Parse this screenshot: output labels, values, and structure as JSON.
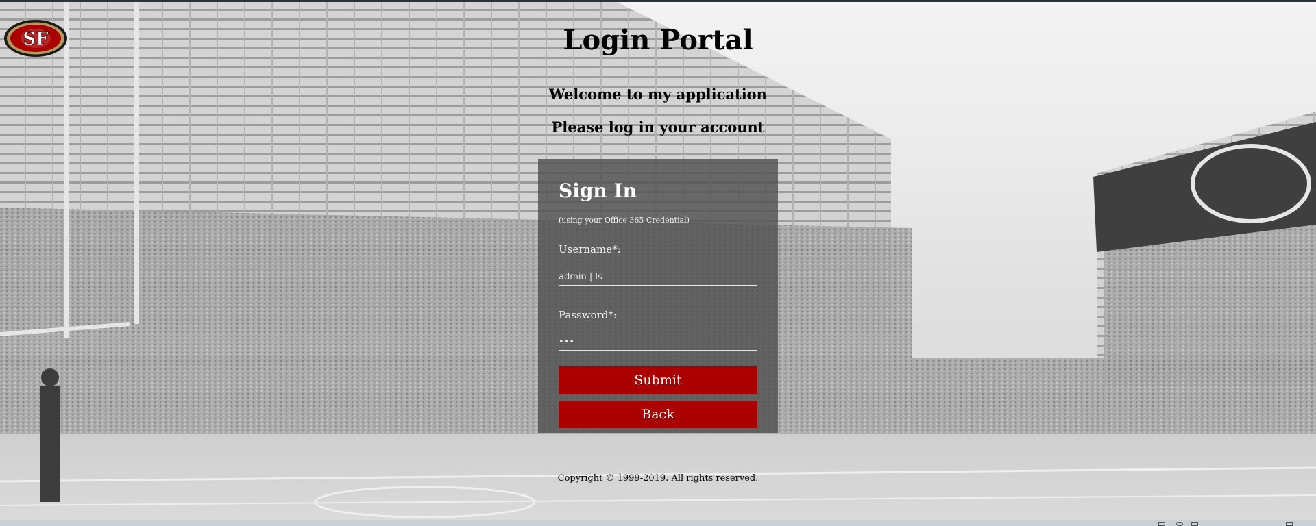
{
  "header": {
    "title": "Login Portal",
    "welcome": "Welcome to my application",
    "prompt": "Please log in your account"
  },
  "logo": {
    "text": "SF",
    "icon": "49ers-logo"
  },
  "form": {
    "heading": "Sign In",
    "subtitle": "(using your Office 365 Credential)",
    "username_label": "Username*:",
    "username_value": "admin | ls",
    "password_label": "Password*:",
    "password_value": "***",
    "submit_label": "Submit",
    "back_label": "Back"
  },
  "footer": {
    "copyright": "Copyright © 1999-2019. All rights reserved."
  },
  "colors": {
    "button": "#aa0000",
    "panel": "#505050",
    "brand": "#aa0000"
  }
}
